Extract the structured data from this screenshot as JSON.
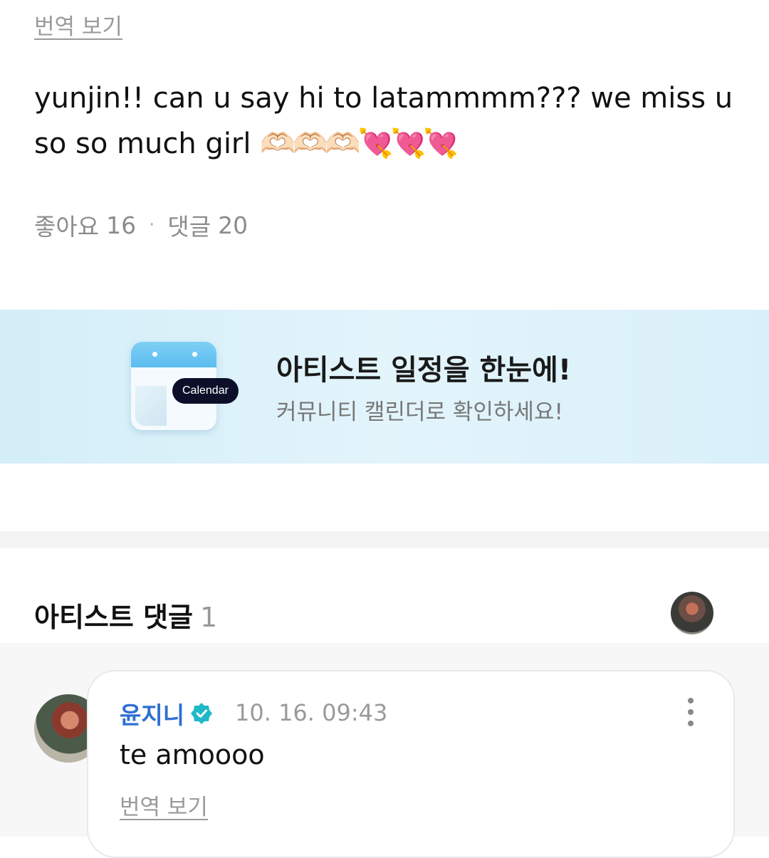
{
  "post": {
    "translate_label": "번역 보기",
    "text": "yunjin!! can u say hi to latammmm??? we miss u so so much girl",
    "emojis": "🫶🏻🫶🏻🫶🏻💘💘💘",
    "likes_label": "좋아요",
    "likes_count": "16",
    "comments_label": "댓글",
    "comments_count": "20"
  },
  "banner": {
    "calendar_tag": "Calendar",
    "title": "아티스트 일정을 한눈에!",
    "subtitle": "커뮤니티 캘린더로 확인하세요!"
  },
  "artist_comments": {
    "heading": "아티스트 댓글",
    "count": "1",
    "items": [
      {
        "author": "윤지니",
        "time": "10. 16. 09:43",
        "text": "te amoooo",
        "translate_label": "번역 보기"
      }
    ]
  },
  "colors": {
    "author_blue": "#2e6fd1",
    "verified_teal": "#1fb8c8",
    "muted_gray": "#9a9a9a"
  }
}
